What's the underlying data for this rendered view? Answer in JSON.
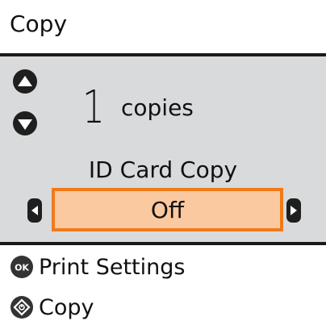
{
  "header": {
    "title": "Copy"
  },
  "copies": {
    "count": "1",
    "label": "copies",
    "increase_icon": "triangle-up-icon",
    "decrease_icon": "triangle-down-icon"
  },
  "setting": {
    "label": "ID Card Copy",
    "value": "Off",
    "prev_icon": "left-arrow-icon",
    "next_icon": "right-arrow-icon"
  },
  "footer": {
    "items": [
      {
        "icon": "ok-button-icon",
        "label": "Print Settings"
      },
      {
        "icon": "start-diamond-icon",
        "label": "Copy"
      }
    ]
  },
  "colors": {
    "panel_bg": "#d9dadb",
    "highlight_fill": "#fac9a0",
    "highlight_border": "#f07a1a",
    "rule": "#1a1a1a"
  }
}
